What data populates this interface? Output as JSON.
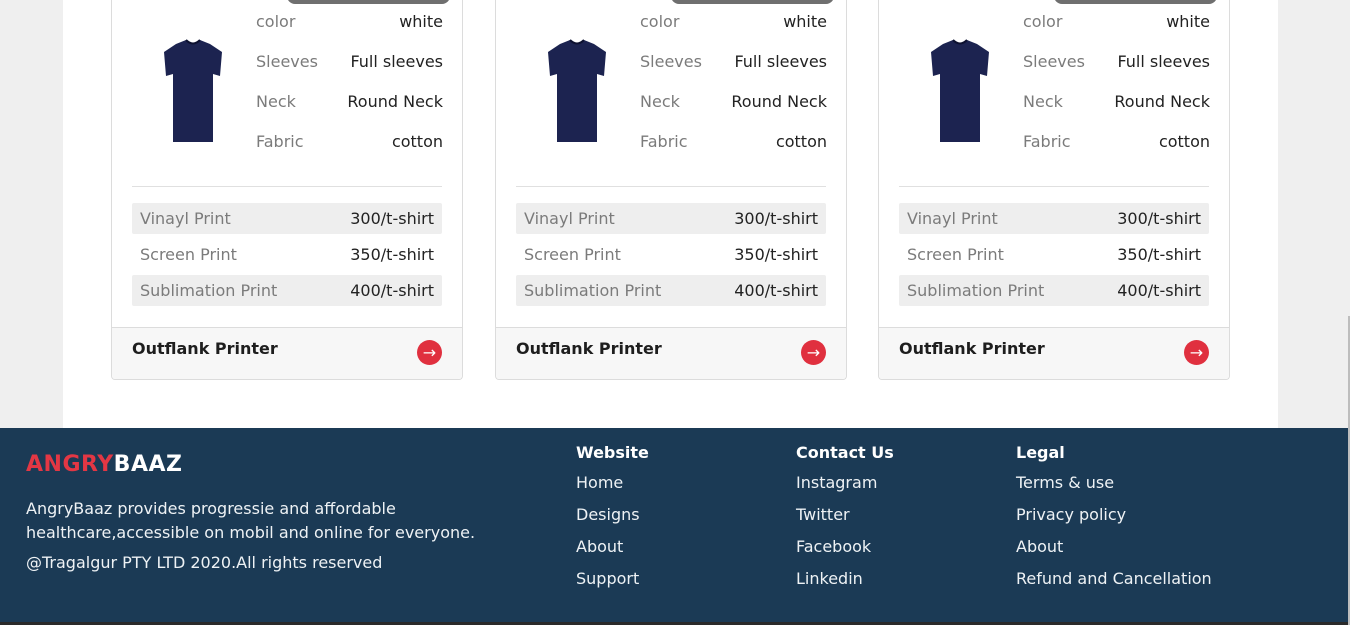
{
  "cards": [
    {
      "specs": [
        {
          "label": "color",
          "value": "white"
        },
        {
          "label": "Sleeves",
          "value": "Full sleeves"
        },
        {
          "label": "Neck",
          "value": "Round Neck"
        },
        {
          "label": "Fabric",
          "value": "cotton"
        }
      ],
      "prices": [
        {
          "label": "Vinayl Print",
          "value": "300/t-shirt"
        },
        {
          "label": "Screen Print",
          "value": "350/t-shirt"
        },
        {
          "label": "Sublimation Print",
          "value": "400/t-shirt"
        }
      ],
      "printer": "Outflank Printer",
      "arrow": "→"
    },
    {
      "specs": [
        {
          "label": "color",
          "value": "white"
        },
        {
          "label": "Sleeves",
          "value": "Full sleeves"
        },
        {
          "label": "Neck",
          "value": "Round Neck"
        },
        {
          "label": "Fabric",
          "value": "cotton"
        }
      ],
      "prices": [
        {
          "label": "Vinayl Print",
          "value": "300/t-shirt"
        },
        {
          "label": "Screen Print",
          "value": "350/t-shirt"
        },
        {
          "label": "Sublimation Print",
          "value": "400/t-shirt"
        }
      ],
      "printer": "Outflank Printer",
      "arrow": "→"
    },
    {
      "specs": [
        {
          "label": "color",
          "value": "white"
        },
        {
          "label": "Sleeves",
          "value": "Full sleeves"
        },
        {
          "label": "Neck",
          "value": "Round Neck"
        },
        {
          "label": "Fabric",
          "value": "cotton"
        }
      ],
      "prices": [
        {
          "label": "Vinayl Print",
          "value": "300/t-shirt"
        },
        {
          "label": "Screen Print",
          "value": "350/t-shirt"
        },
        {
          "label": "Sublimation Print",
          "value": "400/t-shirt"
        }
      ],
      "printer": "Outflank Printer",
      "arrow": "→"
    }
  ],
  "footer": {
    "brand_red": "ANGRY",
    "brand_white": "BAAZ",
    "description": "AngryBaaz provides progressie and affordable healthcare,accessible on mobil and online for everyone.",
    "copyright": "@Tragalgur PTY LTD 2020.All rights reserved",
    "columns": [
      {
        "heading": "Website",
        "links": [
          "Home",
          "Designs",
          "About",
          "Support"
        ]
      },
      {
        "heading": "Contact Us",
        "links": [
          "Instagram",
          "Twitter",
          "Facebook",
          "Linkedin"
        ]
      },
      {
        "heading": "Legal",
        "links": [
          "Terms & use",
          "Privacy policy",
          "About",
          "Refund and Cancellation"
        ]
      }
    ]
  },
  "colors": {
    "accent_red": "#e0303f",
    "footer_bg": "#1b3a55",
    "shirt_navy": "#1c2350"
  },
  "icons": {
    "product_image": "tshirt-icon",
    "card_action": "arrow-right-icon"
  }
}
